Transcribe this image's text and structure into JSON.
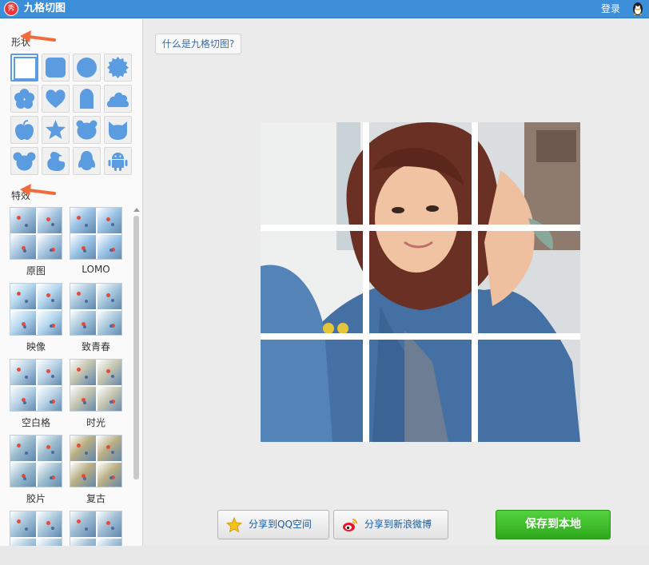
{
  "window": {
    "app_logo_text": "秀",
    "title": "九格切图",
    "login": "登录"
  },
  "sidebar": {
    "shape_section": "形状",
    "effects_section": "特效",
    "shapes": [
      {
        "name": "square",
        "selected": true
      },
      {
        "name": "rounded-square"
      },
      {
        "name": "circle"
      },
      {
        "name": "badge"
      },
      {
        "name": "flower"
      },
      {
        "name": "heart"
      },
      {
        "name": "tombstone"
      },
      {
        "name": "cloud"
      },
      {
        "name": "apple"
      },
      {
        "name": "star"
      },
      {
        "name": "bear"
      },
      {
        "name": "cat"
      },
      {
        "name": "mouse"
      },
      {
        "name": "duck"
      },
      {
        "name": "penguin"
      },
      {
        "name": "android"
      }
    ],
    "effects": [
      {
        "label": "原图",
        "tint": "#a9c6e0"
      },
      {
        "label": "LOMO",
        "tint": "#9bc4e6"
      },
      {
        "label": "映像",
        "tint": "#b5d7ef"
      },
      {
        "label": "致青春",
        "tint": "#a8c8dc"
      },
      {
        "label": "空白格",
        "tint": "#b9d3e6"
      },
      {
        "label": "时光",
        "tint": "#c4c4b0"
      },
      {
        "label": "胶片",
        "tint": "#9fbfd0"
      },
      {
        "label": "复古",
        "tint": "#b9ae84"
      },
      {
        "label": "",
        "tint": "#aac8dc"
      },
      {
        "label": "",
        "tint": "#a0bdd4"
      }
    ]
  },
  "main": {
    "help_button": "什么是九格切图?",
    "share_qzone": "分享到QQ空间",
    "share_weibo": "分享到新浪微博",
    "save_local": "保存到本地"
  },
  "colors": {
    "titlebar": "#3c8ed8",
    "shape_fill": "#5b9be0",
    "save_green": "#3cbd28",
    "arrow": "#f26b3a"
  }
}
